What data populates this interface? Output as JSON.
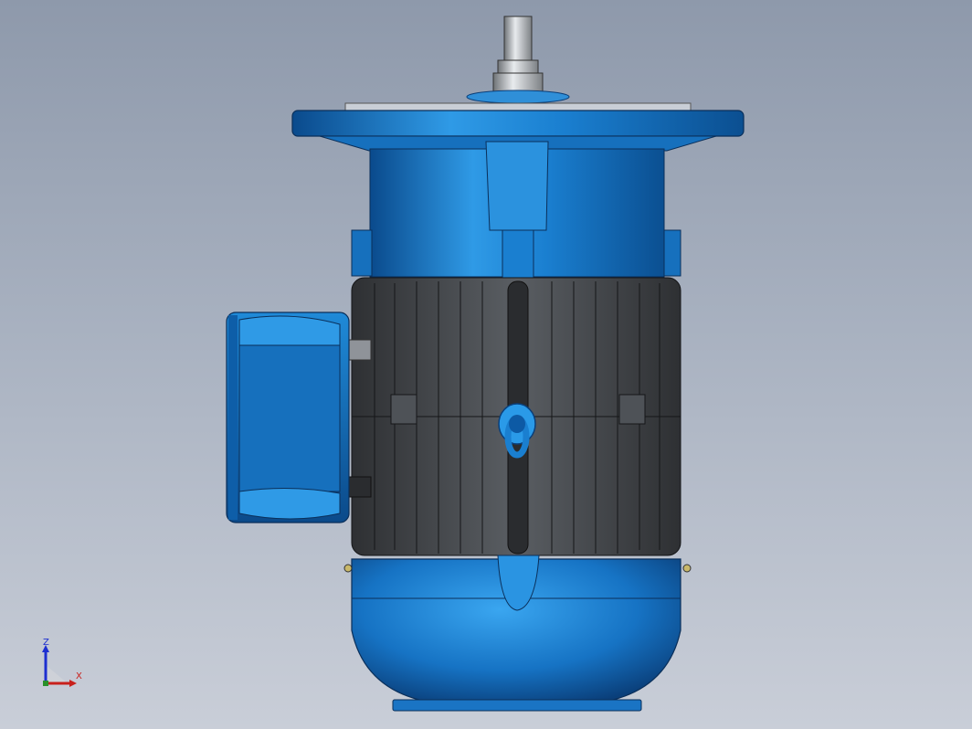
{
  "viewport": {
    "background_top": "#8e99ab",
    "background_bottom": "#c9ced8"
  },
  "model": {
    "body_color": "#1a7fd0",
    "body_dark": "#0b4f91",
    "fin_color": "#4a4d52",
    "parts": [
      "shaft",
      "flange",
      "front-housing",
      "finned-stator",
      "lifting-eye",
      "terminal-box",
      "fan-cover"
    ]
  },
  "triad": {
    "z_label": "Z",
    "x_label": "X",
    "z_color": "#1d2fd0",
    "x_color": "#c8201c"
  }
}
